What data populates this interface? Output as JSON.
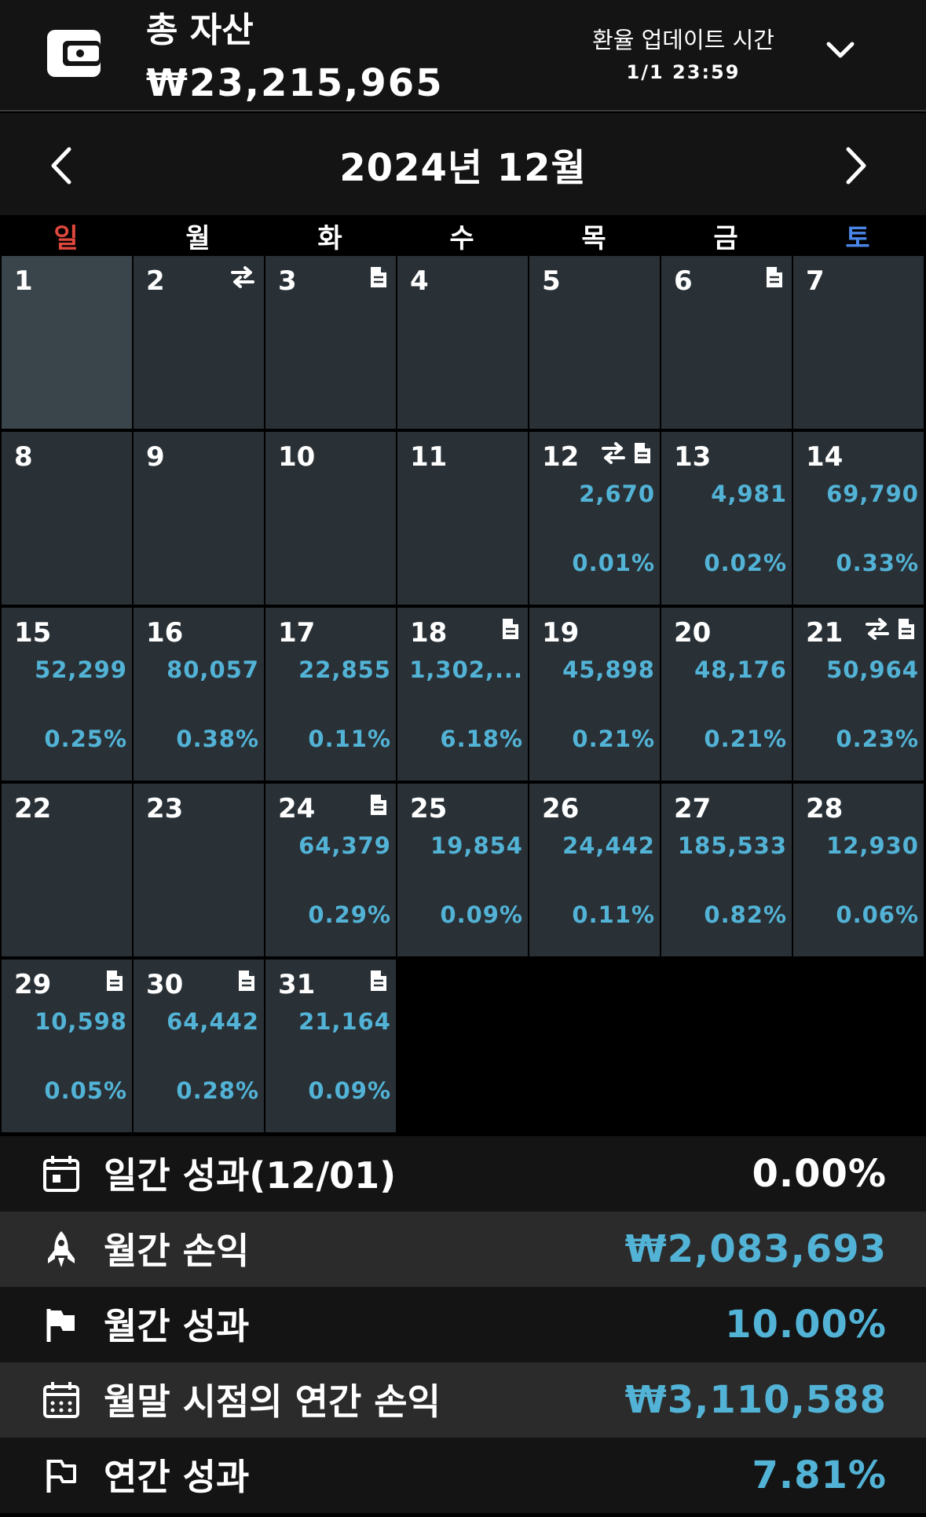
{
  "header": {
    "title": "총 자산",
    "total_assets": "₩23,215,965",
    "rate_update_label": "환율 업데이트 시간",
    "rate_update_time": "1/1 23:59",
    "wallet_icon": "wallet-icon",
    "expand_icon": "chevron-down-icon"
  },
  "month_nav": {
    "title": "2024년 12월",
    "prev_icon": "chevron-left-icon",
    "next_icon": "chevron-right-icon"
  },
  "weekdays": [
    "일",
    "월",
    "화",
    "수",
    "목",
    "금",
    "토"
  ],
  "colors": {
    "sunday": "#e0483e",
    "saturday": "#4a86e8",
    "accent": "#52b3d6",
    "cell": "#293137",
    "today_cell": "#3a444b"
  },
  "calendar": [
    {
      "day": "1",
      "transfer": false,
      "memo": false,
      "amount": "",
      "pct": ""
    },
    {
      "day": "2",
      "transfer": true,
      "memo": false,
      "amount": "",
      "pct": ""
    },
    {
      "day": "3",
      "transfer": false,
      "memo": true,
      "amount": "",
      "pct": ""
    },
    {
      "day": "4",
      "transfer": false,
      "memo": false,
      "amount": "",
      "pct": ""
    },
    {
      "day": "5",
      "transfer": false,
      "memo": false,
      "amount": "",
      "pct": ""
    },
    {
      "day": "6",
      "transfer": false,
      "memo": true,
      "amount": "",
      "pct": ""
    },
    {
      "day": "7",
      "transfer": false,
      "memo": false,
      "amount": "",
      "pct": ""
    },
    {
      "day": "8",
      "transfer": false,
      "memo": false,
      "amount": "",
      "pct": ""
    },
    {
      "day": "9",
      "transfer": false,
      "memo": false,
      "amount": "",
      "pct": ""
    },
    {
      "day": "10",
      "transfer": false,
      "memo": false,
      "amount": "",
      "pct": ""
    },
    {
      "day": "11",
      "transfer": false,
      "memo": false,
      "amount": "",
      "pct": ""
    },
    {
      "day": "12",
      "transfer": true,
      "memo": true,
      "amount": "2,670",
      "pct": "0.01%"
    },
    {
      "day": "13",
      "transfer": false,
      "memo": false,
      "amount": "4,981",
      "pct": "0.02%"
    },
    {
      "day": "14",
      "transfer": false,
      "memo": false,
      "amount": "69,790",
      "pct": "0.33%"
    },
    {
      "day": "15",
      "transfer": false,
      "memo": false,
      "amount": "52,299",
      "pct": "0.25%"
    },
    {
      "day": "16",
      "transfer": false,
      "memo": false,
      "amount": "80,057",
      "pct": "0.38%"
    },
    {
      "day": "17",
      "transfer": false,
      "memo": false,
      "amount": "22,855",
      "pct": "0.11%"
    },
    {
      "day": "18",
      "transfer": false,
      "memo": true,
      "amount": "1,302,...",
      "pct": "6.18%"
    },
    {
      "day": "19",
      "transfer": false,
      "memo": false,
      "amount": "45,898",
      "pct": "0.21%"
    },
    {
      "day": "20",
      "transfer": false,
      "memo": false,
      "amount": "48,176",
      "pct": "0.21%"
    },
    {
      "day": "21",
      "transfer": true,
      "memo": true,
      "amount": "50,964",
      "pct": "0.23%"
    },
    {
      "day": "22",
      "transfer": false,
      "memo": false,
      "amount": "",
      "pct": ""
    },
    {
      "day": "23",
      "transfer": false,
      "memo": false,
      "amount": "",
      "pct": ""
    },
    {
      "day": "24",
      "transfer": false,
      "memo": true,
      "amount": "64,379",
      "pct": "0.29%"
    },
    {
      "day": "25",
      "transfer": false,
      "memo": false,
      "amount": "19,854",
      "pct": "0.09%"
    },
    {
      "day": "26",
      "transfer": false,
      "memo": false,
      "amount": "24,442",
      "pct": "0.11%"
    },
    {
      "day": "27",
      "transfer": false,
      "memo": false,
      "amount": "185,533",
      "pct": "0.82%"
    },
    {
      "day": "28",
      "transfer": false,
      "memo": false,
      "amount": "12,930",
      "pct": "0.06%"
    },
    {
      "day": "29",
      "transfer": false,
      "memo": true,
      "amount": "10,598",
      "pct": "0.05%"
    },
    {
      "day": "30",
      "transfer": false,
      "memo": true,
      "amount": "64,442",
      "pct": "0.28%"
    },
    {
      "day": "31",
      "transfer": false,
      "memo": true,
      "amount": "21,164",
      "pct": "0.09%"
    }
  ],
  "summary": {
    "daily_label": "일간 성과(12/01)",
    "daily_value": "0.00%",
    "monthly_pnl_label": "월간 손익",
    "monthly_pnl_value": "₩2,083,693",
    "monthly_perf_label": "월간 성과",
    "monthly_perf_value": "10.00%",
    "annual_pnl_label": "월말 시점의 연간 손익",
    "annual_pnl_value": "₩3,110,588",
    "annual_perf_label": "연간 성과",
    "annual_perf_value": "7.81%"
  }
}
